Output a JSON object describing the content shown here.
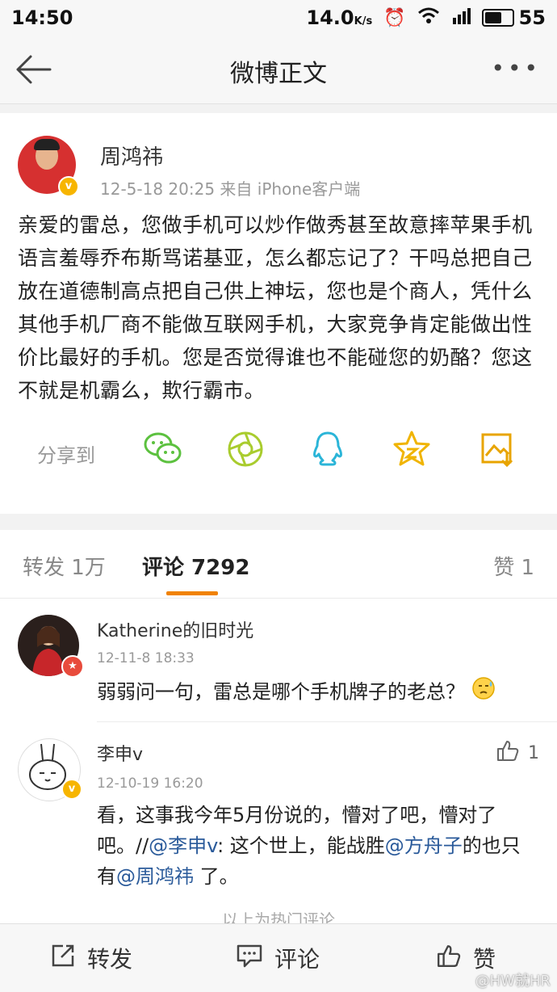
{
  "status": {
    "time": "14:50",
    "speed": "14.0",
    "speed_unit": "K/s",
    "battery": "55"
  },
  "nav": {
    "title": "微博正文",
    "more": "•••"
  },
  "post": {
    "author": "周鸿祎",
    "meta": "12-5-18 20:25  来自 iPhone客户端",
    "text": "亲爱的雷总，您做手机可以炒作做秀甚至故意摔苹果手机语言羞辱乔布斯骂诺基亚，怎么都忘记了？干吗总把自己放在道德制高点把自己供上神坛，您也是个商人，凭什么其他手机厂商不能做互联网手机，大家竞争肯定能做出性价比最好的手机。您是否觉得谁也不能碰您的奶酪？您这不就是机霸么，欺行霸市。",
    "share_label": "分享到",
    "share_icons": [
      "wechat-icon",
      "moments-icon",
      "qq-icon",
      "favorite-icon",
      "save-image-icon"
    ]
  },
  "tabs": {
    "repost": "转发 1万",
    "comment": "评论 7292",
    "like": "赞 1"
  },
  "comments": [
    {
      "name": "Katherine的旧时光",
      "time": "12-11-8 18:33",
      "text": "弱弱问一句，雷总是哪个手机牌子的老总？"
    },
    {
      "name": "李申v",
      "time": "12-10-19 16:20",
      "like_count": "1",
      "text_a": "看，这事我今年5月份说的，懵对了吧，懵对了吧。//",
      "mention1": "@李申v",
      "text_b": ": 这个世上，能战胜",
      "mention2": "@方舟子",
      "text_c": "的也只有",
      "mention3": "@周鸿祎",
      "text_d": " 了。"
    }
  ],
  "hot_footer": "以上为热门评论",
  "bottom": {
    "repost": "转发",
    "comment": "评论",
    "like": "赞"
  },
  "watermark": "@HW就HR"
}
